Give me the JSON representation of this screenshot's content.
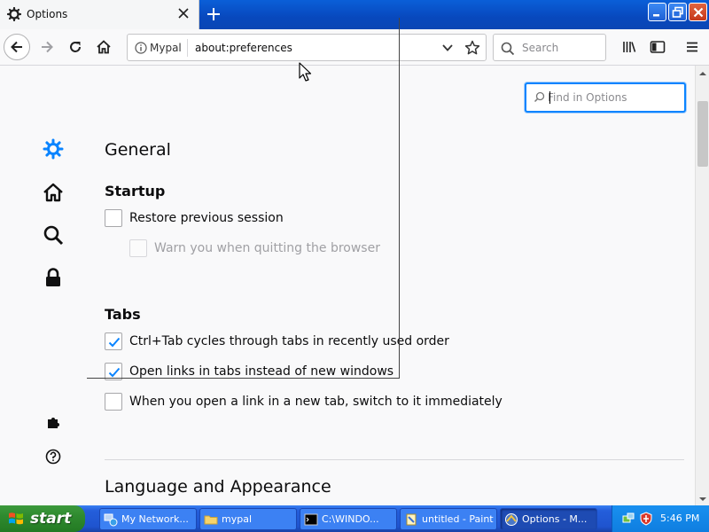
{
  "browser": {
    "tab": {
      "title": "Options"
    },
    "identity_label": "Mypal",
    "url": "about:preferences",
    "search_placeholder": "Search"
  },
  "preferences": {
    "find_placeholder": "Find in Options",
    "categories": [
      "gear-icon",
      "home-icon",
      "search-icon",
      "lock-icon"
    ],
    "footer_categories": [
      "puzzle-icon",
      "help-icon"
    ],
    "general_title": "General",
    "startup": {
      "heading": "Startup",
      "restore_session": {
        "label": "Restore previous session",
        "checked": false
      },
      "warn_quit": {
        "label": "Warn you when quitting the browser",
        "checked": false,
        "disabled": true
      }
    },
    "tabs": {
      "heading": "Tabs",
      "ctrl_tab": {
        "label": "Ctrl+Tab cycles through tabs in recently used order",
        "checked": true
      },
      "open_links": {
        "label": "Open links in tabs instead of new windows",
        "checked": true
      },
      "switch_to_tab": {
        "label": "When you open a link in a new tab, switch to it immediately",
        "checked": false
      }
    },
    "language_title": "Language and Appearance"
  },
  "taskbar": {
    "start_label": "start",
    "tasks": [
      {
        "label": "My Network...",
        "icon": "network-icon"
      },
      {
        "label": "mypal",
        "icon": "folder-icon"
      },
      {
        "label": "C:\\WINDO...",
        "icon": "cmd-icon"
      },
      {
        "label": "untitled - Paint",
        "icon": "paint-icon"
      },
      {
        "label": "Options - M...",
        "icon": "browser-icon",
        "active": true
      }
    ],
    "clock": "5:46 PM"
  },
  "colors": {
    "accent": "#0a84ff",
    "check": "#0a84ff",
    "taskbar": "#245edb",
    "start": "#2f8a2f"
  }
}
